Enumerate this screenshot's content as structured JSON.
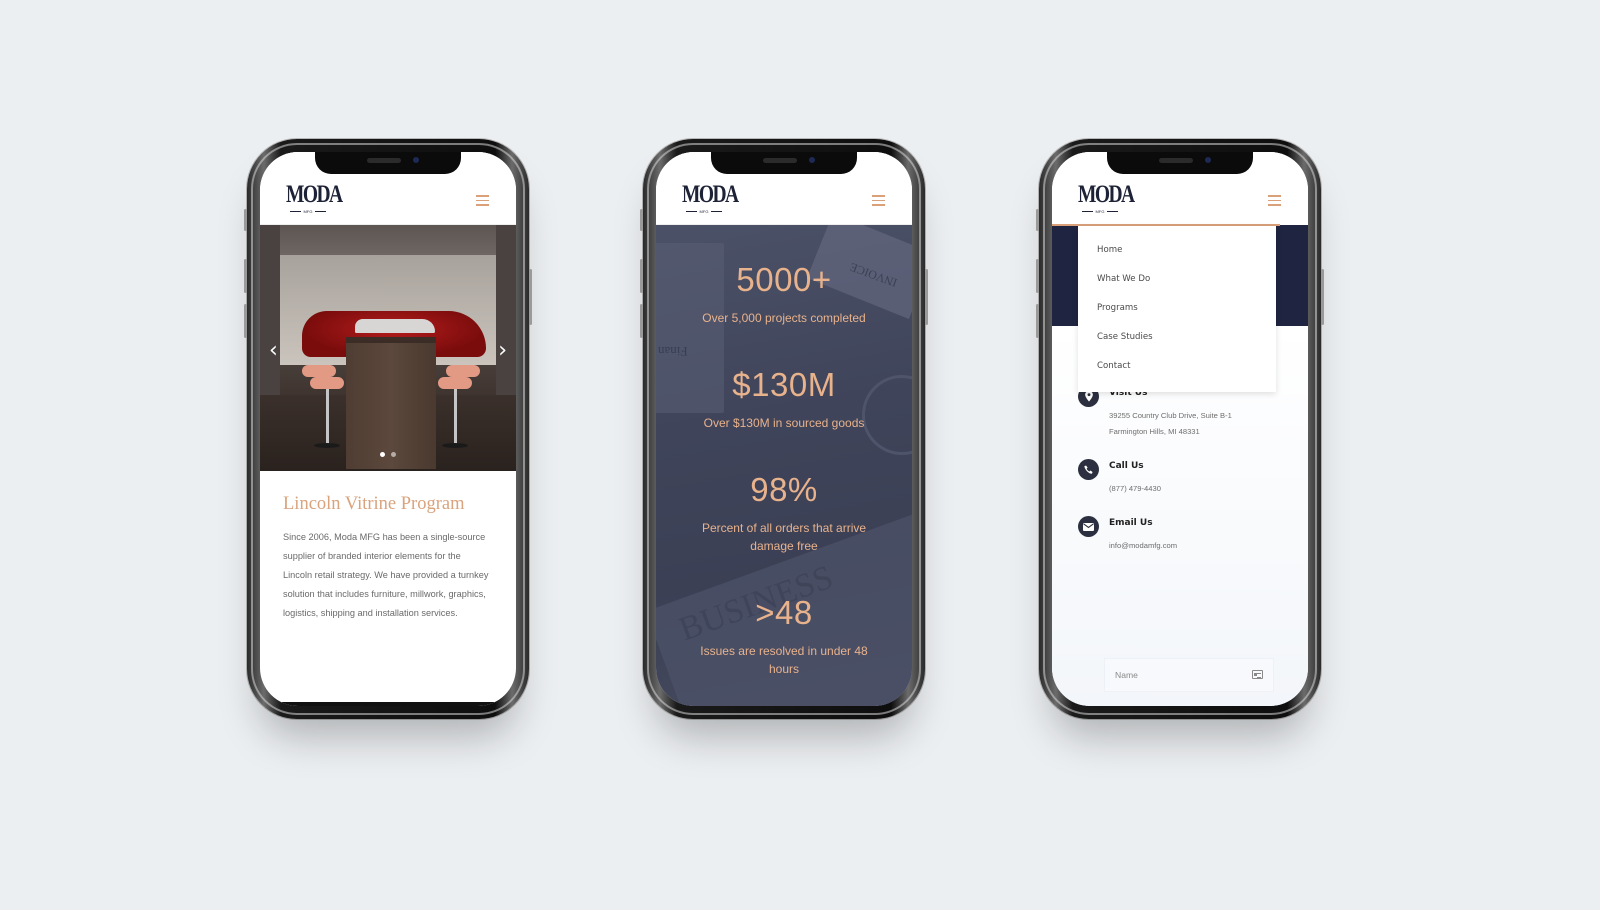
{
  "brand": {
    "logo_text": "MODA",
    "logo_sub": "MFG",
    "accent_color": "#d9a07a",
    "navy_color": "#1f2440"
  },
  "phone1": {
    "slider": {
      "prev_icon": "chevron-left-icon",
      "next_icon": "chevron-right-icon",
      "prev_glyph": "‹",
      "next_glyph": "›",
      "slide_count": 2,
      "active_slide": 1
    },
    "title": "Lincoln Vitrine Program",
    "body": "Since 2006, Moda MFG has been a single-source supplier of branded interior elements for the Lincoln retail strategy. We have provided a turnkey solution that includes furniture, millwork, graphics, logistics, shipping and installation services."
  },
  "phone2": {
    "stats": [
      {
        "value": "5000+",
        "label": "Over 5,000 projects completed"
      },
      {
        "value": "$130M",
        "label": "Over $130M in sourced goods"
      },
      {
        "value": "98%",
        "label": "Percent of all orders that arrive damage free"
      },
      {
        "value": ">48",
        "label": "Issues are resolved in under 48 hours"
      }
    ],
    "background_words": [
      "INVOICE",
      "Finan",
      "BUSINESS"
    ]
  },
  "phone3": {
    "menu": [
      "Home",
      "What We Do",
      "Programs",
      "Case Studies",
      "Contact"
    ],
    "contact": [
      {
        "icon": "map-pin-icon",
        "title": "Visit Us",
        "lines": [
          "39255 Country Club Drive, Suite B-1",
          "Farmington Hills, MI 48331"
        ]
      },
      {
        "icon": "phone-icon",
        "title": "Call Us",
        "lines": [
          "(877) 479-4430"
        ]
      },
      {
        "icon": "envelope-icon",
        "title": "Email Us",
        "lines": [
          "info@modamfg.com"
        ]
      }
    ],
    "name_field": {
      "placeholder": "Name",
      "icon": "contact-card-icon"
    }
  }
}
